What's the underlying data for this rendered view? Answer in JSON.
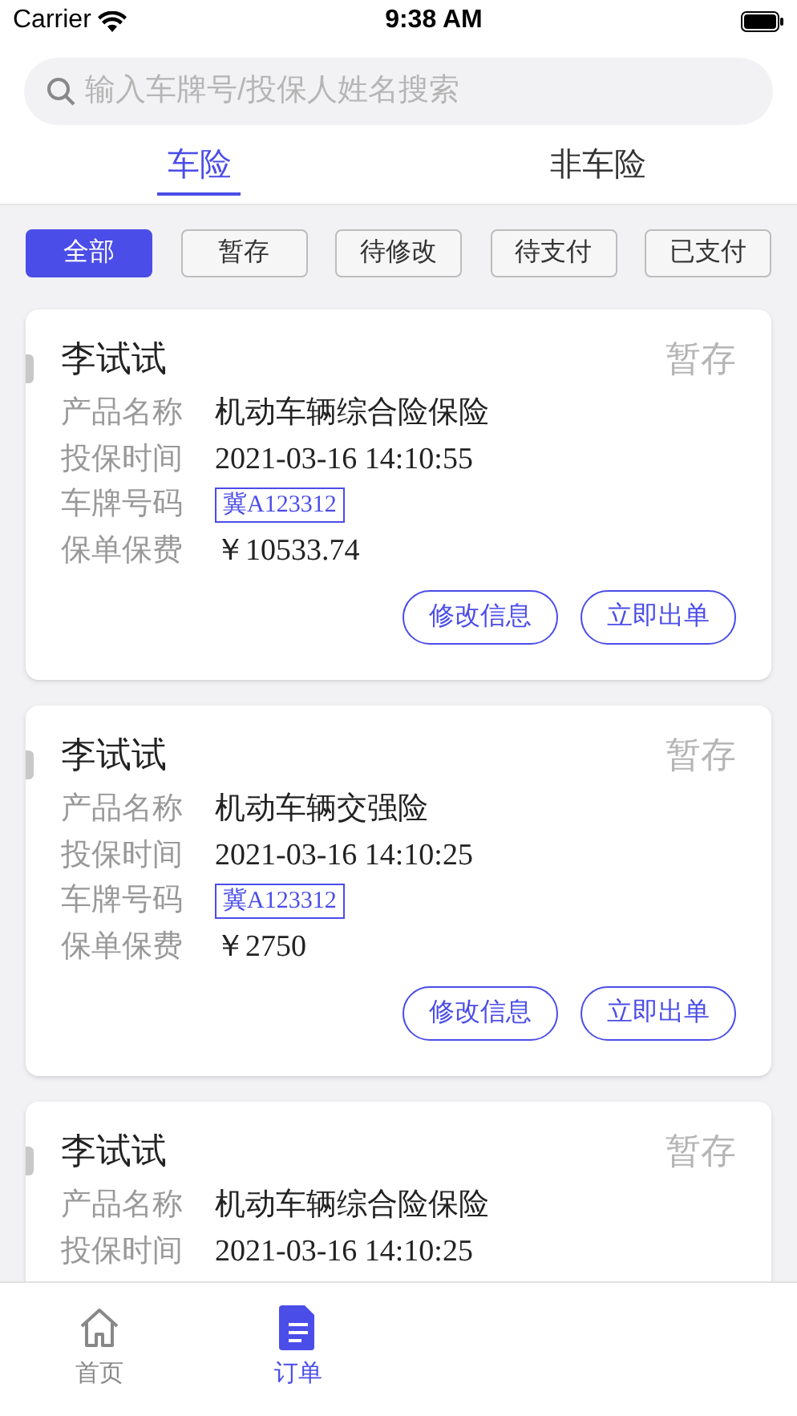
{
  "status_bar": {
    "carrier": "Carrier",
    "time": "9:38 AM"
  },
  "search": {
    "placeholder": "输入车牌号/投保人姓名搜索"
  },
  "tabs": [
    {
      "label": "车险",
      "selected": true
    },
    {
      "label": "非车险",
      "selected": false
    }
  ],
  "filters": [
    {
      "label": "全部",
      "selected": true
    },
    {
      "label": "暂存",
      "selected": false
    },
    {
      "label": "待修改",
      "selected": false
    },
    {
      "label": "待支付",
      "selected": false
    },
    {
      "label": "已支付",
      "selected": false
    }
  ],
  "cards": [
    {
      "name": "李试试",
      "status": "暂存",
      "fields": [
        {
          "kind": "text",
          "label": "产品名称",
          "value": "机动车辆综合险保险"
        },
        {
          "kind": "text",
          "label": "投保时间",
          "value": "2021-03-16 14:10:55"
        },
        {
          "kind": "plate",
          "label": "车牌号码",
          "value": "冀A123312"
        },
        {
          "kind": "text",
          "label": "保单保费",
          "value": "￥10533.74"
        }
      ],
      "buttons": [
        "修改信息",
        "立即出单"
      ]
    },
    {
      "name": "李试试",
      "status": "暂存",
      "fields": [
        {
          "kind": "text",
          "label": "产品名称",
          "value": "机动车辆交强险"
        },
        {
          "kind": "text",
          "label": "投保时间",
          "value": "2021-03-16 14:10:25"
        },
        {
          "kind": "plate",
          "label": "车牌号码",
          "value": "冀A123312"
        },
        {
          "kind": "text",
          "label": "保单保费",
          "value": "￥2750"
        }
      ],
      "buttons": [
        "修改信息",
        "立即出单"
      ]
    },
    {
      "name": "李试试",
      "status": "暂存",
      "fields": [
        {
          "kind": "text",
          "label": "产品名称",
          "value": "机动车辆综合险保险"
        },
        {
          "kind": "text",
          "label": "投保时间",
          "value": "2021-03-16 14:10:25"
        }
      ]
    }
  ],
  "nav": [
    {
      "label": "首页",
      "kind": "home",
      "selected": false
    },
    {
      "label": "订单",
      "kind": "orders",
      "selected": true
    }
  ]
}
